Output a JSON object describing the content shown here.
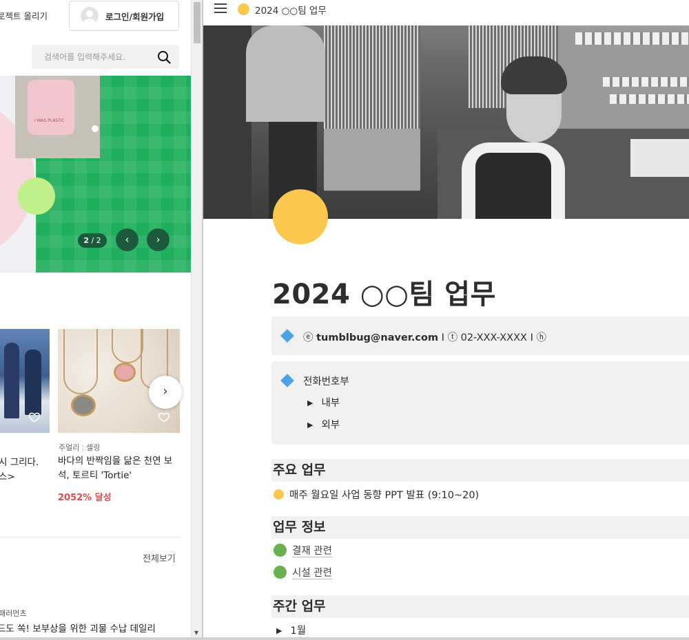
{
  "left": {
    "upload_label": "로젝트 올리기",
    "login_label": "로그인/회원가입",
    "search_placeholder": "검색어를 입력해주세요.",
    "banner": {
      "counter_current": "2",
      "counter_total": "/ 2",
      "prev_glyph": "‹",
      "next_glyph": "›",
      "bag_text": "I WAS PLASTIC"
    },
    "card1": {
      "title_line1": "시 그리다.",
      "title_line2": "스>"
    },
    "card2": {
      "category": "주얼리",
      "creator": "셀링",
      "title": "바다의 반짝임을 닮은 천연 보석, 토르티 'Tortie'",
      "rate": "2052% 달성"
    },
    "next_glyph": "›",
    "view_all": "전체보기",
    "bottom_source": "패러먼츠",
    "bottom_title": "드도 쏙! 보부상을 위한 괴물 수납 데일리"
  },
  "right": {
    "breadcrumb": "2024 ○○팀 업무",
    "page_title": "2024 ○○팀 업무",
    "contact": {
      "email_icon": "ⓔ",
      "email": "tumblbug@naver.com",
      "sep1": "I",
      "phone_icon": "ⓣ",
      "phone": "02-XXX-XXXX",
      "sep2": "I",
      "home_icon": "ⓗ"
    },
    "phonebook": {
      "title": "전화번호부",
      "items": [
        "내부",
        "외부"
      ]
    },
    "sections": {
      "main_task": {
        "heading": "주요 업무",
        "item": "매주 월요일 사업 동향 PPT 발표 (9:10~20)"
      },
      "task_info": {
        "heading": "업무 정보",
        "items": [
          "결재 관련",
          "시설 관련"
        ]
      },
      "weekly": {
        "heading": "주간 업무",
        "items": [
          "1월"
        ]
      }
    },
    "toggle_glyph": "▶",
    "colors": {
      "accent_yellow": "#fcc94e",
      "callout_bg": "#f1f1ef",
      "diamond_blue": "#4da3e8",
      "green": "#6ab04c",
      "banner_green": "#1fae5c",
      "rate_red": "#e84a4a"
    }
  },
  "icons": {
    "search": "search-icon",
    "avatar": "user-avatar-icon",
    "heart": "heart-icon",
    "menu": "hamburger-menu-icon",
    "diamond": "blue-diamond-icon",
    "toggle": "toggle-triangle-icon"
  }
}
